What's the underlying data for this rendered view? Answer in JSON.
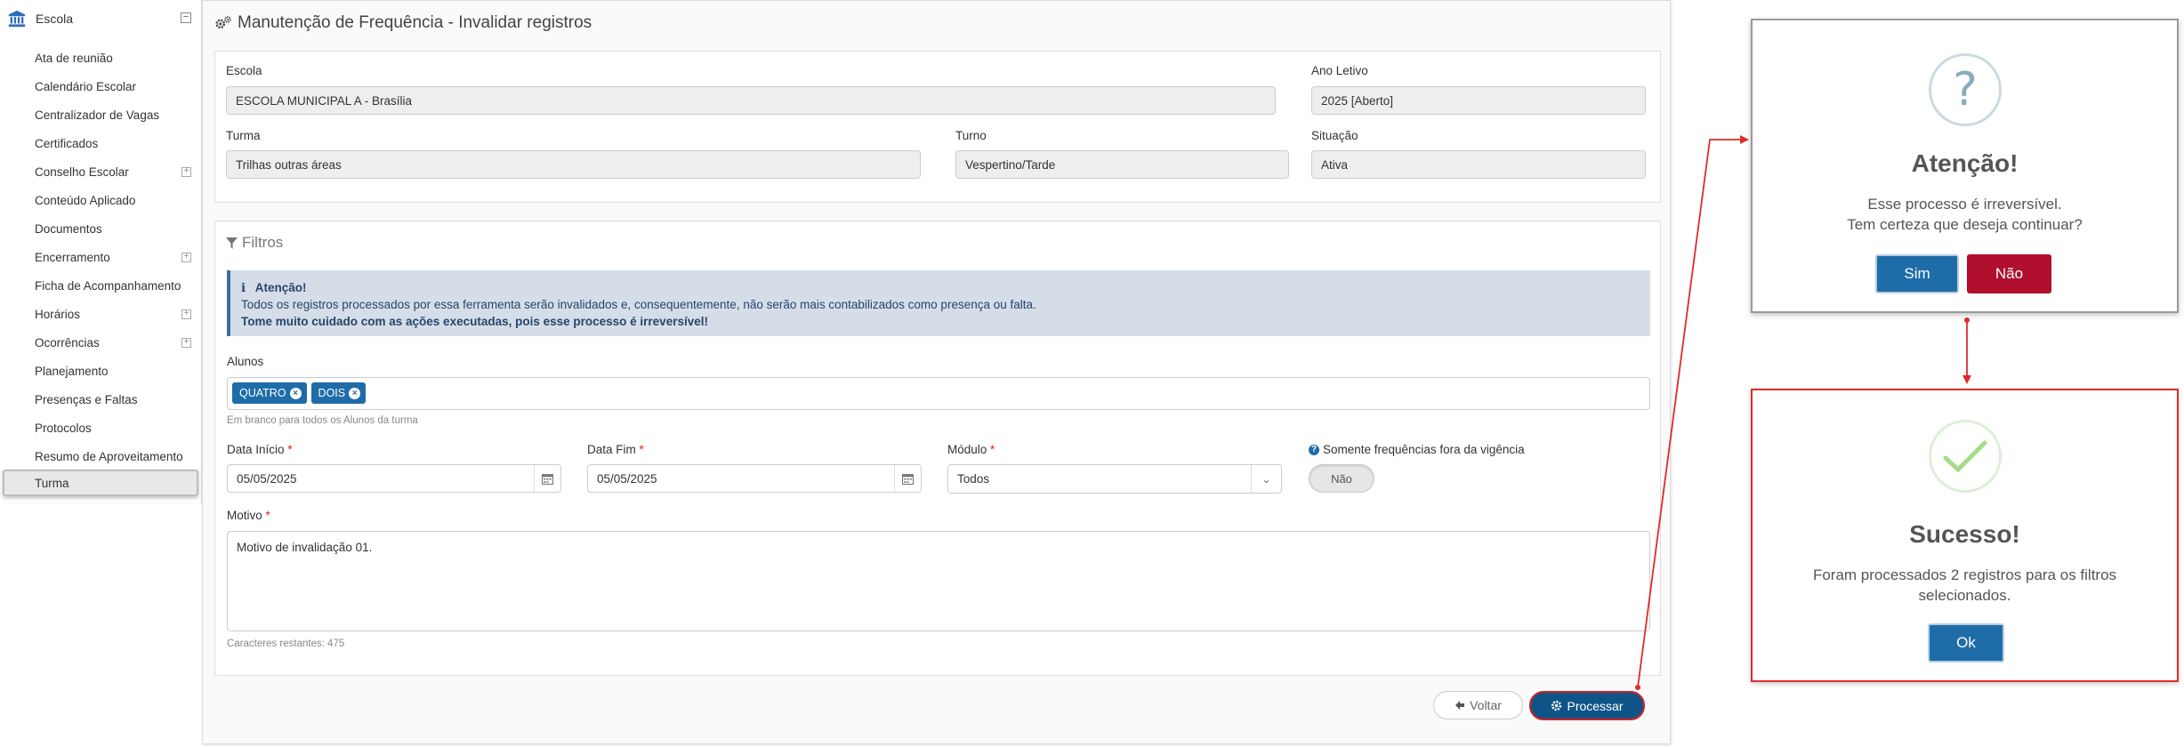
{
  "sidebar": {
    "header": "Escola",
    "items": [
      {
        "label": "Ata de reunião",
        "expandable": false
      },
      {
        "label": "Calendário Escolar",
        "expandable": false
      },
      {
        "label": "Centralizador de Vagas",
        "expandable": false
      },
      {
        "label": "Certificados",
        "expandable": false
      },
      {
        "label": "Conselho Escolar",
        "expandable": true
      },
      {
        "label": "Conteúdo Aplicado",
        "expandable": false
      },
      {
        "label": "Documentos",
        "expandable": false
      },
      {
        "label": "Encerramento",
        "expandable": true
      },
      {
        "label": "Ficha de Acompanhamento",
        "expandable": false
      },
      {
        "label": "Horários",
        "expandable": true
      },
      {
        "label": "Ocorrências",
        "expandable": true
      },
      {
        "label": "Planejamento",
        "expandable": false
      },
      {
        "label": "Presenças e Faltas",
        "expandable": false
      },
      {
        "label": "Protocolos",
        "expandable": false
      },
      {
        "label": "Resumo de Aproveitamento",
        "expandable": false
      },
      {
        "label": "Turma",
        "expandable": false,
        "active": true
      }
    ]
  },
  "page": {
    "title": "Manutenção de Frequência - Invalidar registros"
  },
  "info": {
    "escola_label": "Escola",
    "escola_value": "ESCOLA MUNICIPAL A - Brasília",
    "ano_label": "Ano Letivo",
    "ano_value": "2025 [Aberto]",
    "turma_label": "Turma",
    "turma_value": "Trilhas outras áreas",
    "turno_label": "Turno",
    "turno_value": "Vespertino/Tarde",
    "situacao_label": "Situação",
    "situacao_value": "Ativa"
  },
  "filters": {
    "title": "Filtros",
    "alert": {
      "title": "Atenção!",
      "line1": "Todos os registros processados por essa ferramenta serão invalidados e, consequentemente, não serão mais contabilizados como presença ou falta.",
      "line2": "Tome muito cuidado com as ações executadas, pois esse processo é irreversível!"
    },
    "alunos_label": "Alunos",
    "alunos_tags": [
      "QUATRO",
      "DOIS"
    ],
    "alunos_hint": "Em branco para todos os Alunos da turma",
    "data_inicio_label": "Data Início",
    "data_inicio_value": "05/05/2025",
    "data_fim_label": "Data Fim",
    "data_fim_value": "05/05/2025",
    "modulo_label": "Módulo",
    "modulo_value": "Todos",
    "somente_label": "Somente frequências fora da vigência",
    "somente_value": "Não",
    "required_mark": "*",
    "motivo_label": "Motivo",
    "motivo_value": "Motivo de invalidação 01.",
    "chars_remaining": "Caracteres restantes: 475"
  },
  "actions": {
    "voltar_label": "Voltar",
    "processar_label": "Processar"
  },
  "confirm_dialog": {
    "icon": "question-icon",
    "title": "Atenção!",
    "line1": "Esse processo é irreversível.",
    "line2": "Tem certeza que deseja continuar?",
    "yes_label": "Sim",
    "no_label": "Não"
  },
  "success_dialog": {
    "icon": "check-icon",
    "title": "Sucesso!",
    "line1": "Foram processados 2 registros para os filtros",
    "line2": "selecionados.",
    "ok_label": "Ok"
  },
  "colors": {
    "primary": "#1e6ca8",
    "processar": "#0f5487",
    "danger": "#b10f2e",
    "annotation": "#e02a2a",
    "alert_bg": "#d5dde8"
  }
}
